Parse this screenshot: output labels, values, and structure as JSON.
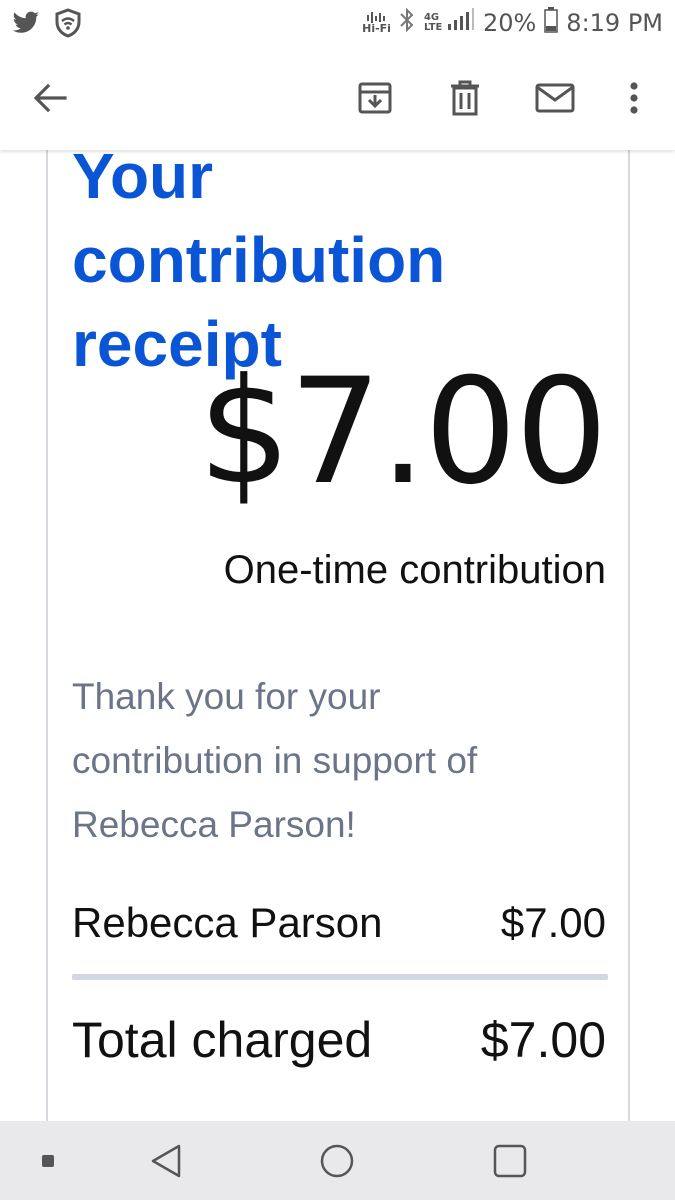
{
  "status_bar": {
    "icons_left": [
      "twitter-icon",
      "shield-wifi-icon"
    ],
    "hifi_label": "Hi-Fi",
    "network_label": "4G LTE",
    "battery_percent": "20%",
    "time": "8:19 PM"
  },
  "toolbar": {
    "icons": [
      "back-arrow-icon",
      "archive-icon",
      "delete-icon",
      "mail-icon",
      "more-vert-icon"
    ]
  },
  "receipt": {
    "heading": "Your contribution receipt",
    "amount": "$7.00",
    "amount_caption": "One-time contribution",
    "thanks_message": "Thank you for your contribution in support of Rebecca Parson!",
    "line_item": {
      "name": "Rebecca Parson",
      "amount": "$7.00"
    },
    "total": {
      "label": "Total charged",
      "amount": "$7.00"
    }
  },
  "colors": {
    "heading": "#0a55d6",
    "muted_text": "#6b7488",
    "divider": "#d3d7e2",
    "nav_bar": "#e9e9ec"
  },
  "nav_bar": {
    "icons": [
      "small-square-icon",
      "back-triangle-icon",
      "home-circle-icon",
      "recents-square-icon"
    ]
  }
}
